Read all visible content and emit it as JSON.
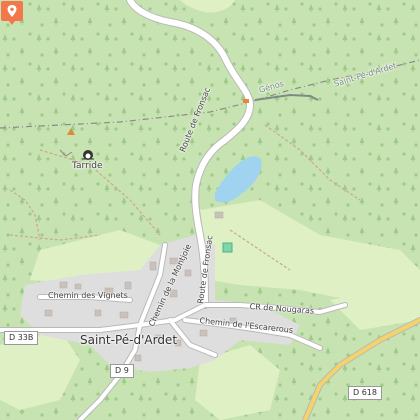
{
  "map": {
    "colors": {
      "forest": "#c8e3b2",
      "meadow": "#dff0c4",
      "village": "#dedede",
      "lake": "#9fd3f0",
      "road": "#ffffff",
      "road_casing": "#b9b9b9",
      "marker": "#f2784b",
      "boundary": "#8a8a8a"
    },
    "places": {
      "village": "Saint-Pé-d'Ardet",
      "hamlet": "Tarride"
    },
    "roads": {
      "route_fronsac_upper": "Route de Fronsac",
      "route_fronsac_lower": "Route de Fronsac",
      "chemin_vignets": "Chemin des Vignets",
      "chemin_montjoie": "Chemin de la Montjoie",
      "cr_nougaras": "CR de Nougaras",
      "chemin_escarerous": "Chemin de l'Escarerous"
    },
    "boundaries": {
      "genos": "Génos",
      "saint_pe": "Saint-Pé-d'Ardet"
    },
    "shields": {
      "d33b": "D 33B",
      "d9": "D 9",
      "d618": "D 618"
    },
    "icons": {
      "marker": "map-pin-icon",
      "cave": "cave-icon",
      "peak": "peak-icon"
    }
  }
}
